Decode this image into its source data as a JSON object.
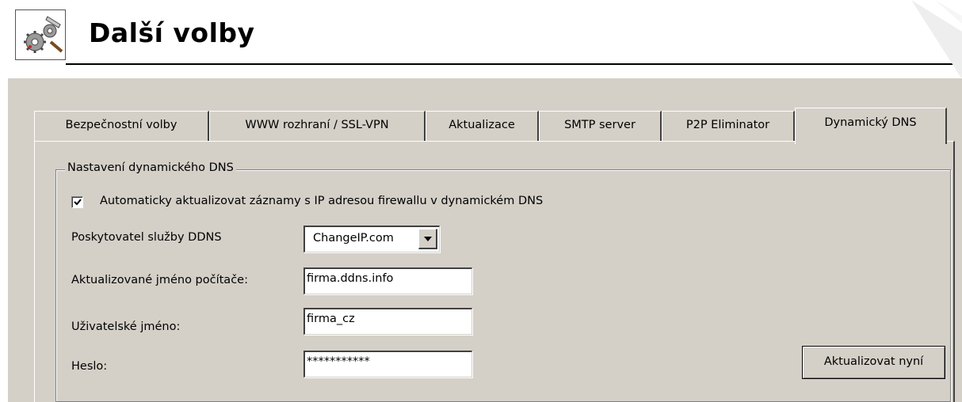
{
  "header": {
    "title": "Další volby",
    "icon": "tools-gear-icon"
  },
  "tabs": [
    {
      "label": "Bezpečnostní volby",
      "active": false
    },
    {
      "label": "WWW rozhraní / SSL-VPN",
      "active": false
    },
    {
      "label": "Aktualizace",
      "active": false
    },
    {
      "label": "SMTP server",
      "active": false
    },
    {
      "label": "P2P Eliminator",
      "active": false
    },
    {
      "label": "Dynamický DNS",
      "active": true
    }
  ],
  "ddns": {
    "group_title": "Nastavení dynamického DNS",
    "auto_update": {
      "label": "Automaticky aktualizovat záznamy s IP adresou firewallu v dynamickém DNS",
      "checked": true
    },
    "provider": {
      "label": "Poskytovatel služby DDNS",
      "value": "ChangeIP.com"
    },
    "hostname": {
      "label": "Aktualizované jméno počítače:",
      "value": "firma.ddns.info"
    },
    "username": {
      "label": "Uživatelské jméno:",
      "value": "firma_cz"
    },
    "password": {
      "label": "Heslo:",
      "value": "***********"
    },
    "update_button": "Aktualizovat nyní"
  },
  "colors": {
    "dialog_bg": "#d4d0c8",
    "field_bg": "#ffffff"
  }
}
